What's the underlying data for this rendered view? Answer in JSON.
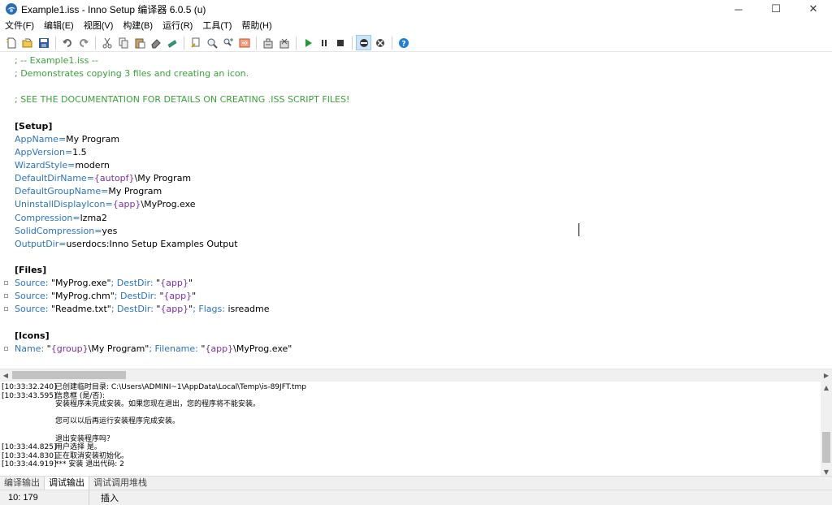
{
  "window": {
    "title": "Example1.iss - Inno Setup 编译器 6.0.5 (u)",
    "controls": {
      "minimize": "─",
      "maximize": "☐",
      "close": "✕"
    }
  },
  "menu": [
    {
      "name": "menu-file",
      "label": "文件(F)"
    },
    {
      "name": "menu-edit",
      "label": "编辑(E)"
    },
    {
      "name": "menu-view",
      "label": "视图(V)"
    },
    {
      "name": "menu-build",
      "label": "构建(B)"
    },
    {
      "name": "menu-run",
      "label": "运行(R)"
    },
    {
      "name": "menu-tools",
      "label": "工具(T)"
    },
    {
      "name": "menu-help",
      "label": "帮助(H)"
    }
  ],
  "toolbar": {
    "icons": [
      "new-file-icon",
      "open-file-icon",
      "save-icon",
      "undo-icon",
      "redo-icon",
      "cut-icon",
      "copy-icon",
      "paste-icon",
      "delete-icon",
      "select-all-icon",
      "find-icon",
      "find-next-icon",
      "replace-icon",
      "goto-icon",
      "compile-icon",
      "stop-compile-icon",
      "run-icon",
      "pause-icon",
      "stop-icon",
      "debug-target-icon",
      "debug-uninstall-icon",
      "help-icon"
    ]
  },
  "editor": {
    "lines": [
      [
        {
          "t": "; -- Example1.iss --",
          "c": "comment"
        }
      ],
      [
        {
          "t": "; Demonstrates copying 3 files and creating an icon.",
          "c": "comment"
        }
      ],
      [],
      [
        {
          "t": "; SEE THE DOCUMENTATION FOR DETAILS ON CREATING .ISS SCRIPT FILES!",
          "c": "comment"
        }
      ],
      [],
      [
        {
          "t": "[Setup]",
          "c": "section"
        }
      ],
      [
        {
          "t": "AppName",
          "c": "key"
        },
        {
          "t": "=",
          "c": "key"
        },
        {
          "t": "My Program",
          "c": "txt"
        }
      ],
      [
        {
          "t": "AppVersion",
          "c": "key"
        },
        {
          "t": "=",
          "c": "key"
        },
        {
          "t": "1.5",
          "c": "txt"
        }
      ],
      [
        {
          "t": "WizardStyle",
          "c": "key"
        },
        {
          "t": "=",
          "c": "key"
        },
        {
          "t": "modern",
          "c": "txt"
        }
      ],
      [
        {
          "t": "DefaultDirName",
          "c": "key"
        },
        {
          "t": "=",
          "c": "key"
        },
        {
          "t": "{autopf}",
          "c": "const"
        },
        {
          "t": "\\My Program",
          "c": "txt"
        }
      ],
      [
        {
          "t": "DefaultGroupName",
          "c": "key"
        },
        {
          "t": "=",
          "c": "key"
        },
        {
          "t": "My Program",
          "c": "txt"
        }
      ],
      [
        {
          "t": "UninstallDisplayIcon",
          "c": "key"
        },
        {
          "t": "=",
          "c": "key"
        },
        {
          "t": "{app}",
          "c": "const"
        },
        {
          "t": "\\MyProg.exe",
          "c": "txt"
        }
      ],
      [
        {
          "t": "Compression",
          "c": "key"
        },
        {
          "t": "=",
          "c": "key"
        },
        {
          "t": "lzma2",
          "c": "txt"
        }
      ],
      [
        {
          "t": "SolidCompression",
          "c": "key"
        },
        {
          "t": "=",
          "c": "key"
        },
        {
          "t": "yes",
          "c": "txt"
        }
      ],
      [
        {
          "t": "OutputDir",
          "c": "key"
        },
        {
          "t": "=",
          "c": "key"
        },
        {
          "t": "userdocs:Inno Setup Examples Output",
          "c": "txt"
        }
      ],
      [],
      [
        {
          "t": "[Files]",
          "c": "section"
        }
      ],
      [
        {
          "t": "Source: ",
          "c": "key"
        },
        {
          "t": "\"MyProg.exe\"",
          "c": "txt"
        },
        {
          "t": "; DestDir: ",
          "c": "key"
        },
        {
          "t": "\"",
          "c": "txt"
        },
        {
          "t": "{app}",
          "c": "const"
        },
        {
          "t": "\"",
          "c": "txt"
        }
      ],
      [
        {
          "t": "Source: ",
          "c": "key"
        },
        {
          "t": "\"MyProg.chm\"",
          "c": "txt"
        },
        {
          "t": "; DestDir: ",
          "c": "key"
        },
        {
          "t": "\"",
          "c": "txt"
        },
        {
          "t": "{app}",
          "c": "const"
        },
        {
          "t": "\"",
          "c": "txt"
        }
      ],
      [
        {
          "t": "Source: ",
          "c": "key"
        },
        {
          "t": "\"Readme.txt\"",
          "c": "txt"
        },
        {
          "t": "; DestDir: ",
          "c": "key"
        },
        {
          "t": "\"",
          "c": "txt"
        },
        {
          "t": "{app}",
          "c": "const"
        },
        {
          "t": "\"",
          "c": "txt"
        },
        {
          "t": "; Flags: ",
          "c": "key"
        },
        {
          "t": "isreadme",
          "c": "txt"
        }
      ],
      [],
      [
        {
          "t": "[Icons]",
          "c": "section"
        }
      ],
      [
        {
          "t": "Name: ",
          "c": "key"
        },
        {
          "t": "\"",
          "c": "txt"
        },
        {
          "t": "{group}",
          "c": "const"
        },
        {
          "t": "\\My Program\"",
          "c": "txt"
        },
        {
          "t": "; Filename: ",
          "c": "key"
        },
        {
          "t": "\"",
          "c": "txt"
        },
        {
          "t": "{app}",
          "c": "const"
        },
        {
          "t": "\\MyProg.exe\"",
          "c": "txt"
        }
      ]
    ],
    "fold_lines": [
      17,
      18,
      19,
      22
    ]
  },
  "output": {
    "lines": [
      {
        "time": "[10:33:32.240]",
        "text": "已创建临时目录: C:\\Users\\ADMINI~1\\AppData\\Local\\Temp\\is-89JFT.tmp"
      },
      {
        "time": "[10:33:43.595]",
        "text": "信息框 (是/否):"
      },
      {
        "time": "",
        "text": "安装程序未完成安装。如果您现在退出，您的程序将不能安装。"
      },
      {
        "time": "",
        "text": ""
      },
      {
        "time": "",
        "text": "您可以以后再运行安装程序完成安装。"
      },
      {
        "time": "",
        "text": ""
      },
      {
        "time": "",
        "text": "退出安装程序吗？"
      },
      {
        "time": "[10:33:44.825]",
        "text": "用户选择 是。"
      },
      {
        "time": "[10:33:44.830]",
        "text": "正在取消安装初始化。"
      },
      {
        "time": "[10:33:44.919]",
        "text": "*** 安装 退出代码: 2"
      }
    ]
  },
  "tabs": [
    {
      "name": "tab-compiler-output",
      "label": "编译输出",
      "active": false
    },
    {
      "name": "tab-debug-output",
      "label": "调试输出",
      "active": true
    },
    {
      "name": "tab-debug-call-stack",
      "label": "调试调用堆栈",
      "active": false
    }
  ],
  "status": {
    "position": "10: 179",
    "mode": "插入"
  }
}
